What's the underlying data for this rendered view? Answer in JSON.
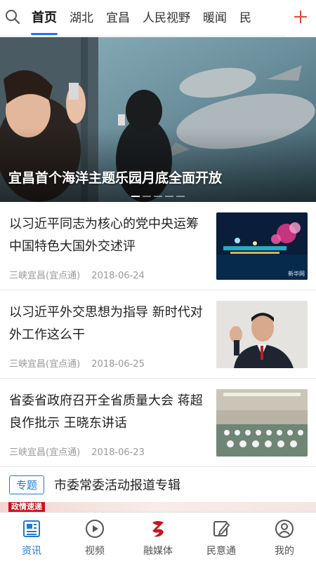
{
  "top_tabs": {
    "items": [
      "首页",
      "湖北",
      "宜昌",
      "人民视野",
      "暖闻",
      "民"
    ],
    "active_index": 0,
    "accent_color": "#1e7ad6",
    "plus_color": "#e8473e"
  },
  "hero": {
    "title": "宜昌首个海洋主题乐园月底全面开放",
    "slide_count": 5,
    "active_slide": 0
  },
  "news": [
    {
      "title": "以习近平同志为核心的党中央运筹中国特色大国外交述评",
      "source": "三峡宜昌(宜点通)",
      "date": "2018-06-24",
      "thumb_watermark": "新华网"
    },
    {
      "title": "以习近平外交思想为指导 新时代对外工作这么干",
      "source": "三峡宜昌(宜点通)",
      "date": "2018-06-25"
    },
    {
      "title": "省委省政府召开全省质量大会 蒋超良作批示 王晓东讲话",
      "source": "三峡宜昌(宜点通)",
      "date": "2018-06-23"
    }
  ],
  "special": {
    "badge": "专题",
    "title": "市委常委活动报道专辑",
    "strip_tag": "政情速递"
  },
  "bottom_nav": {
    "items": [
      {
        "label": "资讯",
        "icon": "news-icon"
      },
      {
        "label": "视频",
        "icon": "play-icon"
      },
      {
        "label": "融媒体",
        "icon": "media-logo-icon"
      },
      {
        "label": "民意通",
        "icon": "edit-icon"
      },
      {
        "label": "我的",
        "icon": "user-icon"
      }
    ],
    "active_index": 0,
    "active_color": "#1e7ad6",
    "logo_color": "#c8161d"
  }
}
